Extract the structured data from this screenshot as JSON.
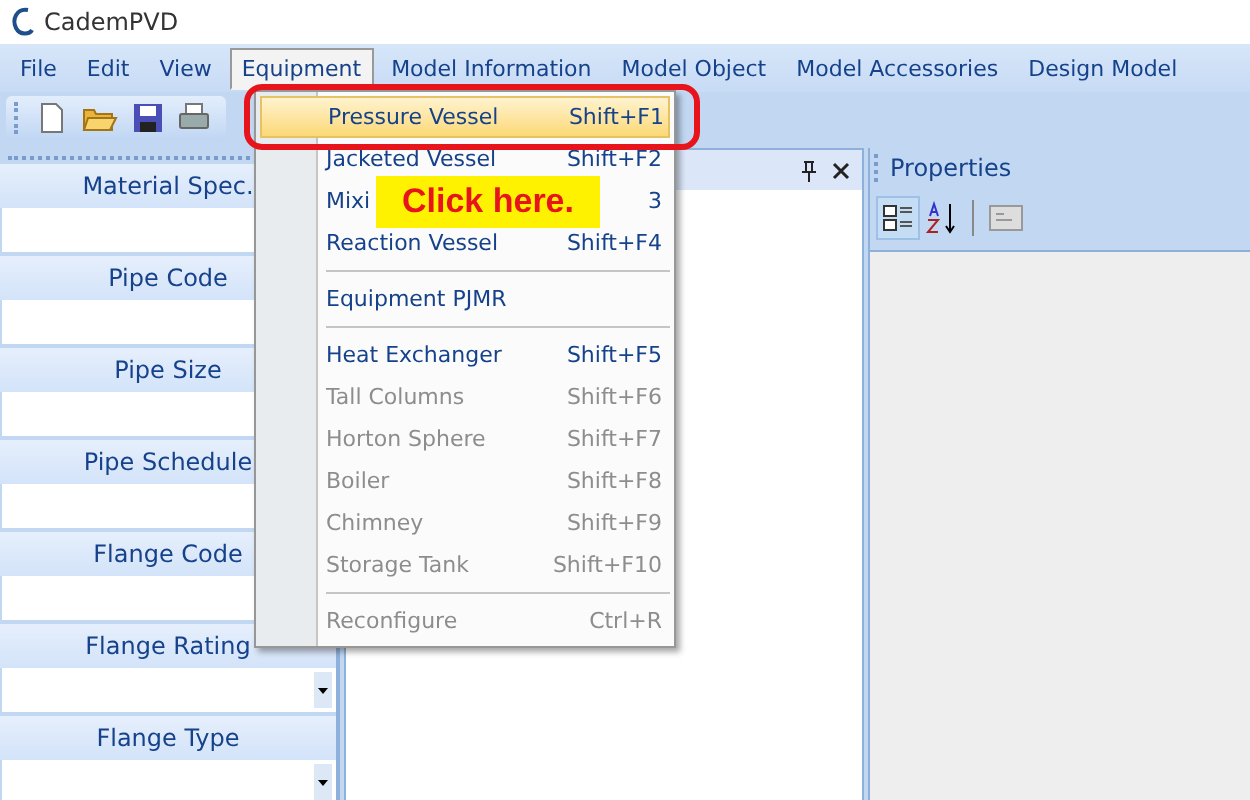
{
  "window": {
    "title": "CademPVD"
  },
  "menu_bar": [
    {
      "label": "File",
      "selected": false
    },
    {
      "label": "Edit",
      "selected": false
    },
    {
      "label": "View",
      "selected": false
    },
    {
      "label": "Equipment",
      "selected": true
    },
    {
      "label": "Model Information",
      "selected": false
    },
    {
      "label": "Model Object",
      "selected": false
    },
    {
      "label": "Model Accessories",
      "selected": false
    },
    {
      "label": "Design Model",
      "selected": false
    }
  ],
  "toolbar": [
    {
      "kind": "new"
    },
    {
      "kind": "open"
    },
    {
      "kind": "save"
    },
    {
      "kind": "print"
    }
  ],
  "left_panel": {
    "fields": [
      {
        "label": "Material Spec.",
        "kind": "text"
      },
      {
        "label": "Pipe Code",
        "kind": "text"
      },
      {
        "label": "Pipe Size",
        "kind": "text"
      },
      {
        "label": "Pipe Schedule",
        "kind": "text"
      },
      {
        "label": "Flange Code",
        "kind": "text"
      },
      {
        "label": "Flange Rating",
        "kind": "dropdown"
      },
      {
        "label": "Flange Type",
        "kind": "dropdown"
      }
    ]
  },
  "properties_panel": {
    "title": "Properties"
  },
  "equipment_menu": [
    {
      "kind": "item",
      "label": "Pressure Vessel",
      "shortcut": "Shift+F1",
      "selected": true,
      "disabled": false
    },
    {
      "kind": "item",
      "label": "Jacketed Vessel",
      "shortcut": "Shift+F2",
      "selected": false,
      "disabled": false
    },
    {
      "kind": "item",
      "label": "Mixi",
      "shortcut": "3",
      "selected": false,
      "disabled": false
    },
    {
      "kind": "item",
      "label": "Reaction Vessel",
      "shortcut": "Shift+F4",
      "selected": false,
      "disabled": false
    },
    {
      "kind": "separator"
    },
    {
      "kind": "item",
      "label": "Equipment PJMR",
      "selected": false,
      "disabled": false
    },
    {
      "kind": "separator"
    },
    {
      "kind": "item",
      "label": "Heat Exchanger",
      "shortcut": "Shift+F5",
      "selected": false,
      "disabled": false
    },
    {
      "kind": "item",
      "label": "Tall Columns",
      "shortcut": "Shift+F6",
      "selected": false,
      "disabled": true
    },
    {
      "kind": "item",
      "label": "Horton Sphere",
      "shortcut": "Shift+F7",
      "selected": false,
      "disabled": true
    },
    {
      "kind": "item",
      "label": "Boiler",
      "shortcut": "Shift+F8",
      "selected": false,
      "disabled": true
    },
    {
      "kind": "item",
      "label": "Chimney",
      "shortcut": "Shift+F9",
      "selected": false,
      "disabled": true
    },
    {
      "kind": "item",
      "label": "Storage Tank",
      "shortcut": "Shift+F10",
      "selected": false,
      "disabled": true
    },
    {
      "kind": "separator"
    },
    {
      "kind": "item",
      "label": "Reconfigure",
      "shortcut": "Ctrl+R",
      "selected": false,
      "disabled": true
    }
  ],
  "callout": {
    "text": "Click here."
  }
}
